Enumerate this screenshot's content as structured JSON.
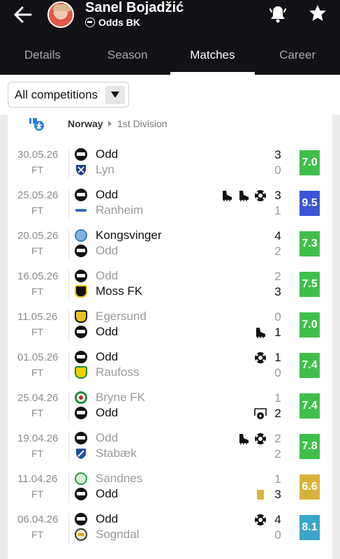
{
  "header": {
    "player_name": "Sanel Bojadžić",
    "club": "Odds BK"
  },
  "tabs": [
    {
      "label": "Details",
      "active": false
    },
    {
      "label": "Season",
      "active": false
    },
    {
      "label": "Matches",
      "active": true
    },
    {
      "label": "Career",
      "active": false
    }
  ],
  "filter": {
    "selected": "All competitions"
  },
  "competition": {
    "country": "Norway",
    "league": "1st Division"
  },
  "matches": [
    {
      "date": "30.05.26",
      "status": "FT",
      "home": "Odd",
      "away": "Lyn",
      "home_score": "3",
      "away_score": "0",
      "player_side": "home",
      "rating": "7.0",
      "rating_color": "#3fbf4a",
      "events_home": [],
      "events_away": []
    },
    {
      "date": "25.05.26",
      "status": "FT",
      "home": "Odd",
      "away": "Ranheim",
      "home_score": "3",
      "away_score": "1",
      "player_side": "home",
      "rating": "9.5",
      "rating_color": "#3a55d6",
      "events_home": [
        "assist-boot-icon",
        "assist-boot-icon",
        "goal-ball-icon"
      ],
      "events_away": []
    },
    {
      "date": "20.05.26",
      "status": "FT",
      "home": "Kongsvinger",
      "away": "Odd",
      "home_score": "4",
      "away_score": "2",
      "player_side": "away",
      "rating": "7.3",
      "rating_color": "#3fbf4a",
      "events_home": [],
      "events_away": []
    },
    {
      "date": "16.05.26",
      "status": "FT",
      "home": "Odd",
      "away": "Moss FK",
      "home_score": "2",
      "away_score": "3",
      "player_side": "home",
      "rating": "7.5",
      "rating_color": "#3fbf4a",
      "events_home": [],
      "events_away": []
    },
    {
      "date": "11.05.26",
      "status": "FT",
      "home": "Egersund",
      "away": "Odd",
      "home_score": "0",
      "away_score": "1",
      "player_side": "away",
      "rating": "7.0",
      "rating_color": "#3fbf4a",
      "events_home": [],
      "events_away": [
        "assist-boot-icon"
      ]
    },
    {
      "date": "01.05.26",
      "status": "FT",
      "home": "Odd",
      "away": "Raufoss",
      "home_score": "1",
      "away_score": "0",
      "player_side": "home",
      "rating": "7.4",
      "rating_color": "#3fbf4a",
      "events_home": [
        "goal-ball-icon"
      ],
      "events_away": []
    },
    {
      "date": "25.04.26",
      "status": "FT",
      "home": "Bryne FK",
      "away": "Odd",
      "home_score": "1",
      "away_score": "2",
      "player_side": "away",
      "rating": "7.4",
      "rating_color": "#3fbf4a",
      "events_home": [],
      "events_away": [
        "penalty-goal-icon"
      ]
    },
    {
      "date": "19.04.26",
      "status": "FT",
      "home": "Odd",
      "away": "Stabæk",
      "home_score": "2",
      "away_score": "2",
      "player_side": "home",
      "rating": "7.8",
      "rating_color": "#3fbf4a",
      "events_home": [
        "assist-boot-icon",
        "goal-ball-icon"
      ],
      "events_away": []
    },
    {
      "date": "11.04.26",
      "status": "FT",
      "home": "Sandnes",
      "away": "Odd",
      "home_score": "1",
      "away_score": "3",
      "player_side": "away",
      "rating": "6.6",
      "rating_color": "#d9b23a",
      "events_home": [],
      "events_away": [
        "yellow-card-icon"
      ]
    },
    {
      "date": "06.04.26",
      "status": "FT",
      "home": "Odd",
      "away": "Sogndal",
      "home_score": "4",
      "away_score": "0",
      "player_side": "home",
      "rating": "8.1",
      "rating_color": "#3aa6c9",
      "events_home": [
        "goal-ball-icon"
      ],
      "events_away": []
    }
  ]
}
